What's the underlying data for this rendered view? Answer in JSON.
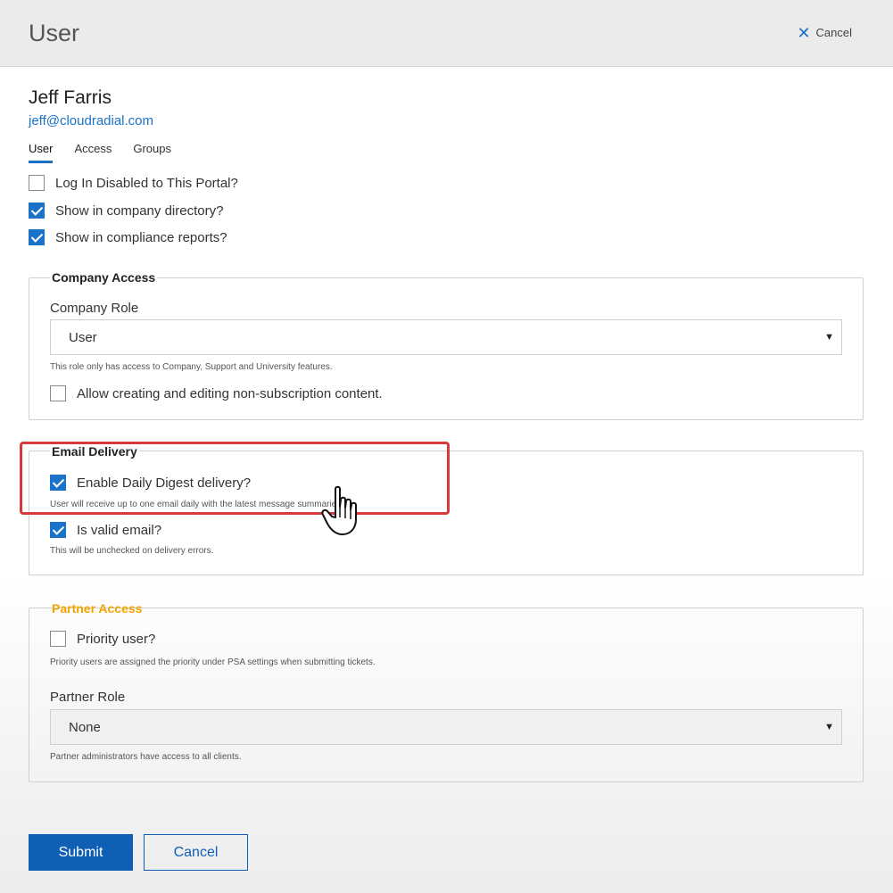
{
  "header": {
    "title": "User",
    "cancel_label": "Cancel"
  },
  "user": {
    "name": "Jeff Farris",
    "email": "jeff@cloudradial.com"
  },
  "tabs": [
    {
      "label": "User",
      "active": true
    },
    {
      "label": "Access",
      "active": false
    },
    {
      "label": "Groups",
      "active": false
    }
  ],
  "options": [
    {
      "label": "Log In Disabled to This Portal?",
      "checked": false
    },
    {
      "label": "Show in company directory?",
      "checked": true
    },
    {
      "label": "Show in compliance reports?",
      "checked": true
    }
  ],
  "company_access": {
    "legend": "Company Access",
    "role_label": "Company Role",
    "role_value": "User",
    "role_help": "This role only has access to Company, Support and University features.",
    "allow_label": "Allow creating and editing non-subscription content.",
    "allow_checked": false
  },
  "email_delivery": {
    "legend": "Email Delivery",
    "digest_label": "Enable Daily Digest delivery?",
    "digest_checked": true,
    "digest_help": "User will receive up to one email daily with the latest message summaries.",
    "valid_label": "Is valid email?",
    "valid_checked": true,
    "valid_help": "This will be unchecked on delivery errors."
  },
  "partner_access": {
    "legend": "Partner Access",
    "legend_color": "#f0a500",
    "priority_label": "Priority user?",
    "priority_checked": false,
    "priority_help": "Priority users are assigned the priority under PSA settings when submitting tickets.",
    "role_label": "Partner Role",
    "role_value": "None",
    "role_help": "Partner administrators have access to all clients."
  },
  "actions": {
    "submit_label": "Submit",
    "cancel_label": "Cancel"
  },
  "colors": {
    "accent": "#1a73c8",
    "primary_button": "#0f5fb5",
    "highlight": "#d8393d"
  },
  "icons": {
    "close": "close-icon",
    "caret": "chevron-down-icon",
    "cursor": "hand-pointer-icon"
  }
}
